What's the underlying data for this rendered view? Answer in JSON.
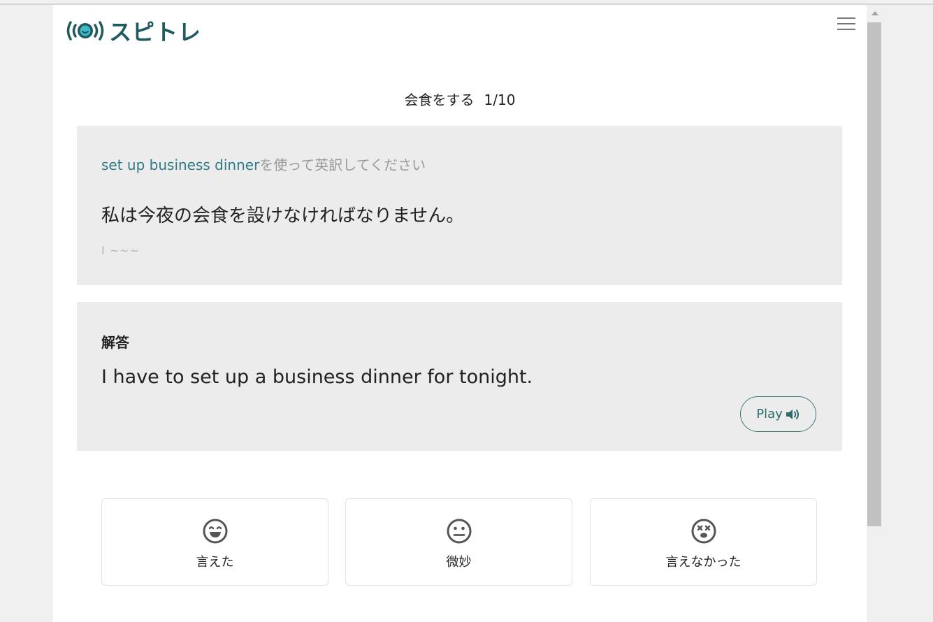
{
  "header": {
    "logo_text": "スピトレ",
    "logo_icon": "signal-face-icon",
    "menu_icon": "hamburger-icon"
  },
  "lesson": {
    "title": "会食をする",
    "progress": "1/10"
  },
  "question": {
    "phrase": "set up business dinner",
    "instruction_suffix": "を使って英訳してください",
    "sentence": "私は今夜の会食を設けなければなりません。",
    "hint": "I ~~~"
  },
  "answer": {
    "label": "解答",
    "text": "I have to set up a business dinner for tonight.",
    "play_label": "Play",
    "play_icon": "speaker-icon"
  },
  "ratings": [
    {
      "label": "言えた",
      "icon": "happy-face-icon"
    },
    {
      "label": "微妙",
      "icon": "neutral-face-icon"
    },
    {
      "label": "言えなかった",
      "icon": "dizzy-face-icon"
    }
  ],
  "colors": {
    "brand": "#1f5a5f",
    "accent": "#2e7a86",
    "card_bg": "#ececec",
    "muted_text": "#9a9a9a"
  }
}
